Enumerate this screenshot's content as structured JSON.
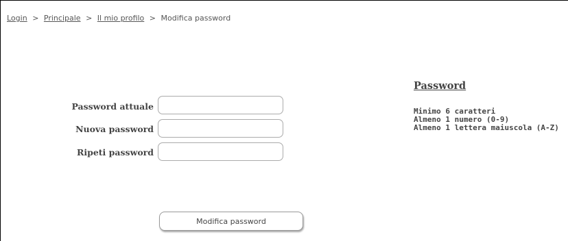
{
  "breadcrumb": {
    "items": [
      "Login",
      "Principale",
      "Il mio profilo"
    ],
    "separator": ">",
    "current": "Modifica password"
  },
  "form": {
    "current_label": "Password attuale",
    "new_label": "Nuova password",
    "repeat_label": "Ripeti password",
    "current_value": "",
    "new_value": "",
    "repeat_value": "",
    "submit_label": "Modifica password"
  },
  "requirements": {
    "title": "Password",
    "items": [
      "Minimo 6 caratteri",
      "Almeno 1 numero (0-9)",
      "Almeno 1 lettera maiuscola (A-Z)"
    ]
  }
}
